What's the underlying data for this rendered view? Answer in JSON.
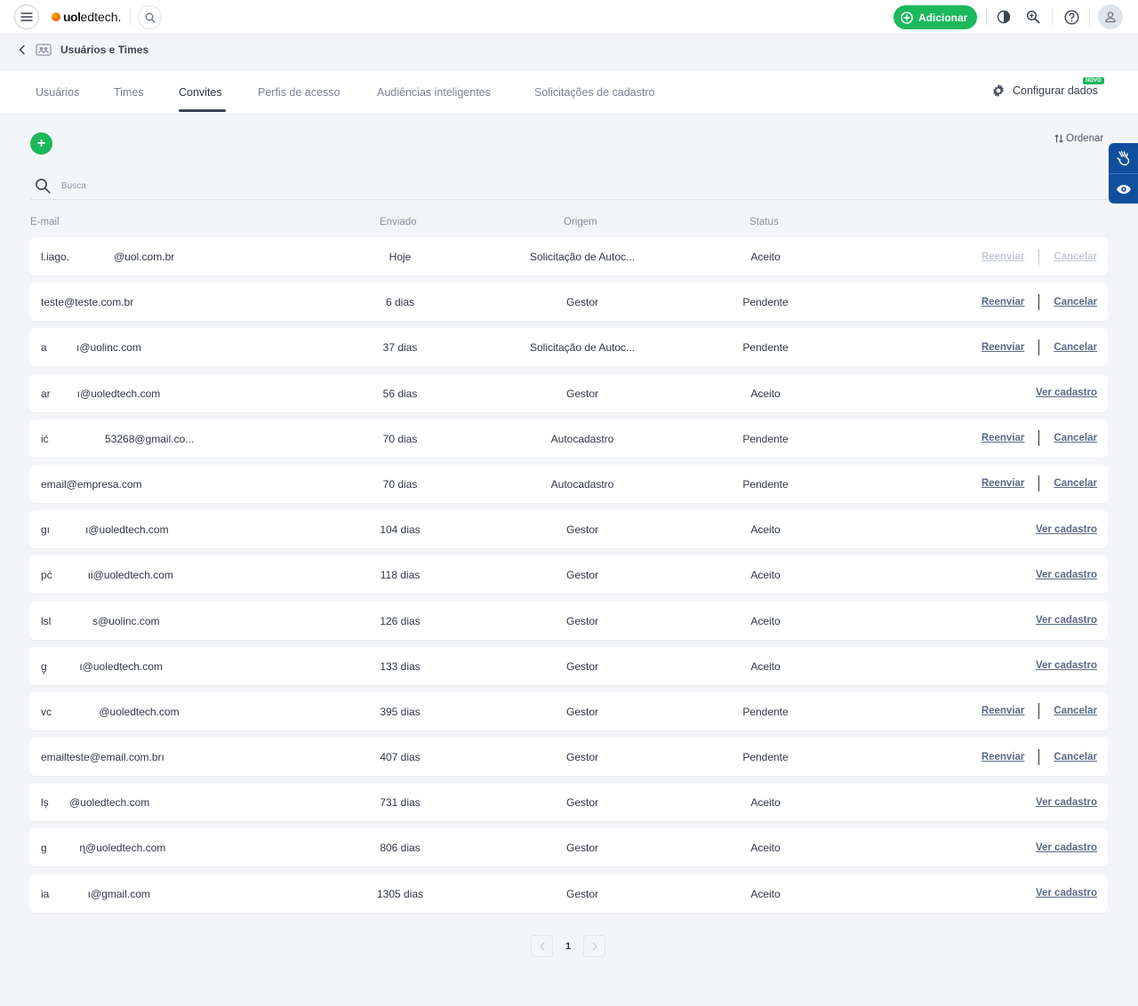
{
  "brand": {
    "logo_uol": "uol",
    "logo_ed": "edtech."
  },
  "topbar": {
    "add_label": "Adicionar"
  },
  "breadcrumb": {
    "title": "Usuários e Times"
  },
  "tabs": [
    {
      "label": "Usuários"
    },
    {
      "label": "Times"
    },
    {
      "label": "Convites"
    },
    {
      "label": "Perfis de acesso"
    },
    {
      "label": "Audiências inteligentes"
    },
    {
      "label": "Solicitações de cadastro"
    }
  ],
  "config": {
    "label": "Configurar dados",
    "badge": "NOVO"
  },
  "toolbar": {
    "add_symbol": "+",
    "order_label": "Ordenar"
  },
  "search": {
    "placeholder": "Busca"
  },
  "table": {
    "headers": {
      "email": "E-mail",
      "sent": "Enviado",
      "origin": "Origem",
      "status": "Status"
    },
    "rows": [
      {
        "email": "l.iago.               @uol.com.br",
        "sent": "Hoje",
        "origin": "Solicitação de Autoc...",
        "status": "Aceito",
        "actions": [
          "Reenviar",
          "Cancelar"
        ],
        "disabled": true
      },
      {
        "email": "teste@teste.com.br",
        "sent": "6 dias",
        "origin": "Gestor",
        "status": "Pendente",
        "actions": [
          "Reenviar",
          "Cancelar"
        ],
        "disabled": false
      },
      {
        "email": "a          ı@uolinc.com",
        "sent": "37 dias",
        "origin": "Solicitação de Autoc...",
        "status": "Pendente",
        "actions": [
          "Reenviar",
          "Cancelar"
        ],
        "disabled": false
      },
      {
        "email": "ar         ı@uoledtech.com",
        "sent": "56 dias",
        "origin": "Gestor",
        "status": "Aceito",
        "actions": [
          "Ver cadastro"
        ],
        "disabled": false
      },
      {
        "email": "ić                   53268@gmail.co...",
        "sent": "70 dias",
        "origin": "Autocadastro",
        "status": "Pendente",
        "actions": [
          "Reenviar",
          "Cancelar"
        ],
        "disabled": false
      },
      {
        "email": "email@empresa.com",
        "sent": "70 dias",
        "origin": "Autocadastro",
        "status": "Pendente",
        "actions": [
          "Reenviar",
          "Cancelar"
        ],
        "disabled": false
      },
      {
        "email": "gı            ı@uoledtech.com",
        "sent": "104 dias",
        "origin": "Gestor",
        "status": "Aceito",
        "actions": [
          "Ver cadastro"
        ],
        "disabled": false
      },
      {
        "email": "pć            ıi@uoledtech.com",
        "sent": "118 dias",
        "origin": "Gestor",
        "status": "Aceito",
        "actions": [
          "Ver cadastro"
        ],
        "disabled": false
      },
      {
        "email": "lsl              s@uolinc.com",
        "sent": "126 dias",
        "origin": "Gestor",
        "status": "Aceito",
        "actions": [
          "Ver cadastro"
        ],
        "disabled": false
      },
      {
        "email": "g̦           ı@uoledtech.com",
        "sent": "133 dias",
        "origin": "Gestor",
        "status": "Aceito",
        "actions": [
          "Ver cadastro"
        ],
        "disabled": false
      },
      {
        "email": "vc                @uoledtech.com",
        "sent": "395 dias",
        "origin": "Gestor",
        "status": "Pendente",
        "actions": [
          "Reenviar",
          "Cancelar"
        ],
        "disabled": false
      },
      {
        "email": "emailteste@email.com.brı",
        "sent": "407 dias",
        "origin": "Gestor",
        "status": "Pendente",
        "actions": [
          "Reenviar",
          "Cancelar"
        ],
        "disabled": false
      },
      {
        "email": "lș       @uoledtech.com",
        "sent": "731 dias",
        "origin": "Gestor",
        "status": "Aceito",
        "actions": [
          "Ver cadastro"
        ],
        "disabled": false
      },
      {
        "email": "g           ɳ@uoledtech.com",
        "sent": "806 dias",
        "origin": "Gestor",
        "status": "Aceito",
        "actions": [
          "Ver cadastro"
        ],
        "disabled": false
      },
      {
        "email": "ia             ı@gmail.com",
        "sent": "1305 dias",
        "origin": "Gestor",
        "status": "Aceito",
        "actions": [
          "Ver cadastro"
        ],
        "disabled": false
      }
    ]
  },
  "pagination": {
    "current": "1"
  },
  "colors": {
    "brand_green": "#1bb85c",
    "accessibility_blue": "#104f9c",
    "link": "#5a6a86"
  },
  "icons": [
    "menu-icon",
    "search-icon",
    "plus-circle-icon",
    "contrast-icon",
    "zoom-icon",
    "help-icon",
    "user-icon",
    "chevron-left-icon",
    "group-icon",
    "gear-icon",
    "sort-icon",
    "sign-language-icon",
    "eye-icon",
    "chevron-right-icon"
  ]
}
